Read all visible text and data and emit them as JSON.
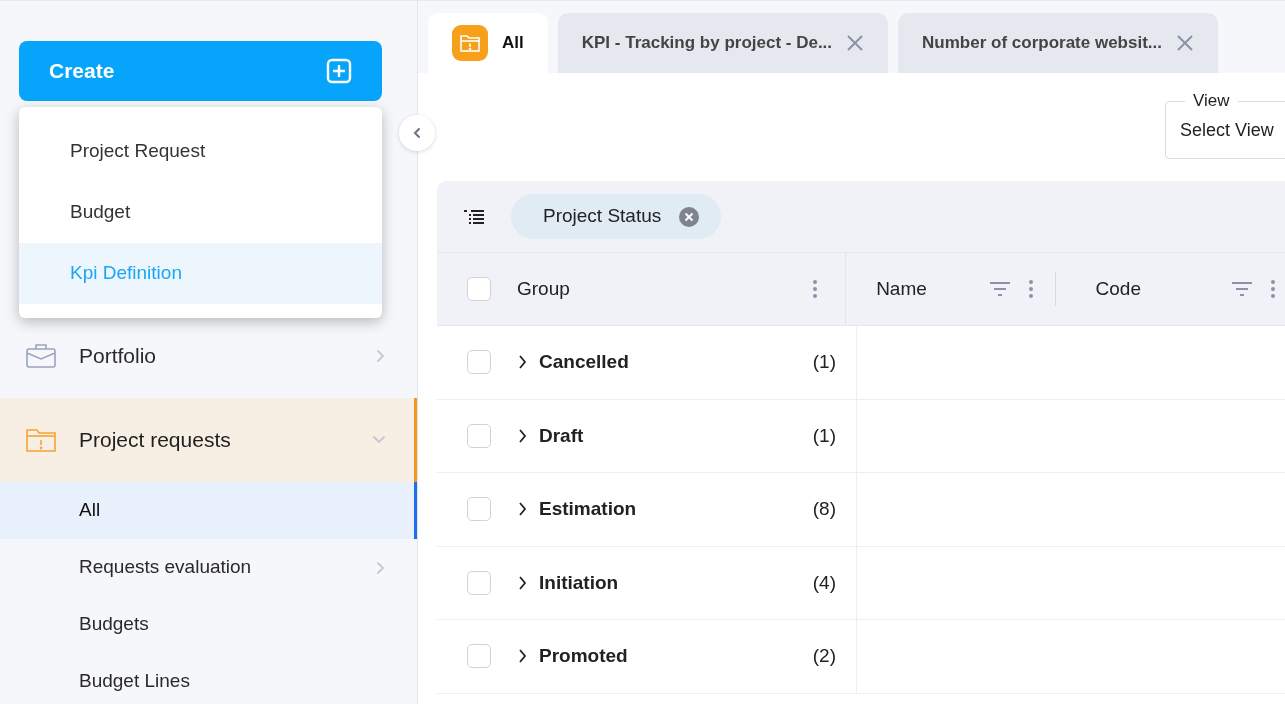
{
  "create_button": {
    "label": "Create"
  },
  "create_menu": {
    "items": [
      {
        "label": "Project Request",
        "selected": false
      },
      {
        "label": "Budget",
        "selected": false
      },
      {
        "label": "Kpi Definition",
        "selected": true
      }
    ]
  },
  "sidebar": {
    "items": [
      {
        "label": "Portfolio",
        "expanded": false,
        "selected": false,
        "has_arrow": true
      },
      {
        "label": "Project requests",
        "expanded": true,
        "selected": true,
        "has_arrow": true,
        "children": [
          {
            "label": "All",
            "selected": true,
            "has_arrow": false
          },
          {
            "label": "Requests evaluation",
            "selected": false,
            "has_arrow": true
          },
          {
            "label": "Budgets",
            "selected": false,
            "has_arrow": false
          },
          {
            "label": "Budget Lines",
            "selected": false,
            "has_arrow": false
          }
        ]
      }
    ]
  },
  "tabs": [
    {
      "label": "All",
      "selected": true,
      "closable": false
    },
    {
      "label": "KPI - Tracking by project - De...",
      "selected": false,
      "closable": true
    },
    {
      "label": "Number of corporate websit...",
      "selected": false,
      "closable": true
    }
  ],
  "view_select": {
    "label": "View",
    "value": "Select View"
  },
  "group_chips": [
    {
      "label": "Project Status"
    }
  ],
  "table": {
    "header_checked": false,
    "columns": [
      {
        "label": "Group",
        "filter": false
      },
      {
        "label": "Name",
        "filter": true
      },
      {
        "label": "Code",
        "filter": true
      }
    ],
    "rows": [
      {
        "group": "Cancelled",
        "count": "(1)",
        "checked": false,
        "expanded": false
      },
      {
        "group": "Draft",
        "count": "(1)",
        "checked": false,
        "expanded": false
      },
      {
        "group": "Estimation",
        "count": "(8)",
        "checked": false,
        "expanded": false
      },
      {
        "group": "Initiation",
        "count": "(4)",
        "checked": false,
        "expanded": false
      },
      {
        "group": "Promoted",
        "count": "(2)",
        "checked": false,
        "expanded": false
      }
    ]
  }
}
